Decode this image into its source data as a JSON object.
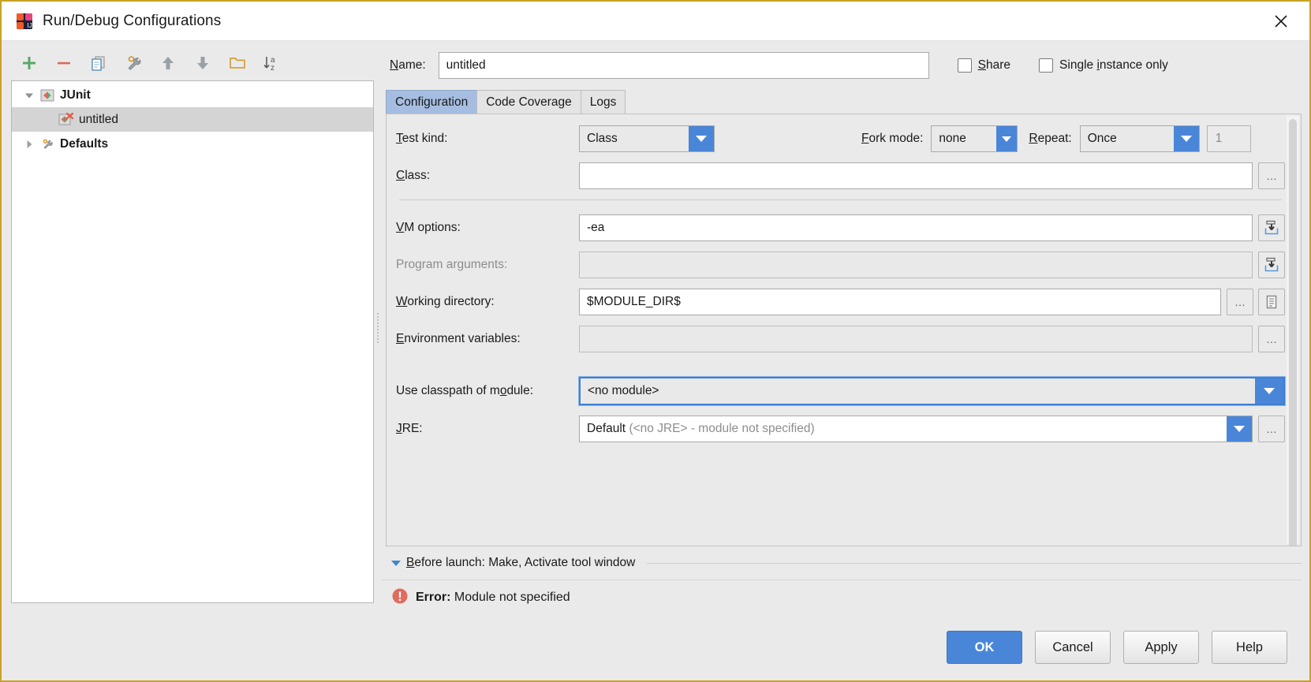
{
  "window": {
    "title": "Run/Debug Configurations",
    "app_icon": "intellij-idea-icon",
    "close_label": "✕"
  },
  "toolbar": {
    "items": [
      {
        "name": "add-configuration-button",
        "icon": "plus-icon",
        "glyph": "+"
      },
      {
        "name": "remove-configuration-button",
        "icon": "minus-icon",
        "glyph": "−"
      },
      {
        "name": "copy-configuration-button",
        "icon": "copy-icon",
        "glyph": "⧉"
      },
      {
        "name": "edit-defaults-button",
        "icon": "wrench-icon",
        "glyph": "🔧"
      },
      {
        "name": "move-up-button",
        "icon": "arrow-up-icon",
        "glyph": "↑"
      },
      {
        "name": "move-down-button",
        "icon": "arrow-down-icon",
        "glyph": "↓"
      },
      {
        "name": "create-folder-button",
        "icon": "folder-icon",
        "glyph": "🗀"
      },
      {
        "name": "sort-alphabetically-button",
        "icon": "sort-az-icon",
        "glyph": "↓az"
      }
    ]
  },
  "tree": {
    "nodes": [
      {
        "label": "JUnit",
        "level": 0,
        "expanded": true,
        "selected": false,
        "bold": true,
        "icon": "junit-icon",
        "twisty": "expanded"
      },
      {
        "label": "untitled",
        "level": 1,
        "expanded": false,
        "selected": true,
        "bold": false,
        "icon": "junit-run-error-icon",
        "twisty": "none"
      },
      {
        "label": "Defaults",
        "level": 0,
        "expanded": false,
        "selected": false,
        "bold": true,
        "icon": "wrench-icon",
        "twisty": "collapsed"
      }
    ]
  },
  "name_row": {
    "label": "Name:",
    "label_mnemonic": "N",
    "value": "untitled",
    "placeholder": "",
    "share": {
      "label": "Share",
      "mnemonic": "S",
      "checked": false
    },
    "single_instance": {
      "label": "Single instance only",
      "mnemonic": "i",
      "checked": false
    }
  },
  "tabs": [
    {
      "label": "Configuration",
      "active": true
    },
    {
      "label": "Code Coverage",
      "active": false
    },
    {
      "label": "Logs",
      "active": false
    }
  ],
  "configuration": {
    "test_kind": {
      "label": "Test kind:",
      "mnemonic": "T",
      "value": "Class"
    },
    "fork_mode": {
      "label": "Fork mode:",
      "mnemonic": "F",
      "value": "none"
    },
    "repeat": {
      "label": "Repeat:",
      "mnemonic": "R",
      "value": "Once",
      "count": "1"
    },
    "class": {
      "label": "Class:",
      "mnemonic": "C",
      "value": "",
      "browse": "…"
    },
    "vm_options": {
      "label": "VM options:",
      "mnemonic": "V",
      "value": "-ea",
      "expand_icon": "expand-editor-icon"
    },
    "program_arguments": {
      "label": "Program arguments:",
      "mnemonic": "g",
      "value": "",
      "disabled": true,
      "expand_icon": "expand-editor-icon"
    },
    "working_directory": {
      "label": "Working directory:",
      "mnemonic": "W",
      "value": "$MODULE_DIR$",
      "browse": "…",
      "macro_icon": "macros-icon"
    },
    "environment_variables": {
      "label": "Environment variables:",
      "mnemonic": "E",
      "value": "",
      "disabled": true,
      "browse": "…"
    },
    "use_classpath_of_module": {
      "label": "Use classpath of module:",
      "mnemonic": "o",
      "value": "<no module>",
      "focused": true
    },
    "jre": {
      "label": "JRE:",
      "mnemonic": "J",
      "value_strong": "Default",
      "value_dim": "(<no JRE> - module not specified)",
      "browse": "…"
    }
  },
  "before_launch": {
    "text": "Before launch: Make, Activate tool window",
    "mnemonic": "B",
    "expanded": true
  },
  "error": {
    "icon": "error-icon",
    "prefix": "Error:",
    "message": "Module not specified"
  },
  "footer": {
    "buttons": [
      {
        "label": "OK",
        "primary": true
      },
      {
        "label": "Cancel",
        "primary": false
      },
      {
        "label": "Apply",
        "primary": false
      },
      {
        "label": "Help",
        "primary": false
      }
    ]
  },
  "colors": {
    "accent": "#4a86d8",
    "window_border": "#c9a227",
    "tab_active": "#a5bde0",
    "error": "#e06c5e",
    "panel_bg": "#eaeaea"
  }
}
